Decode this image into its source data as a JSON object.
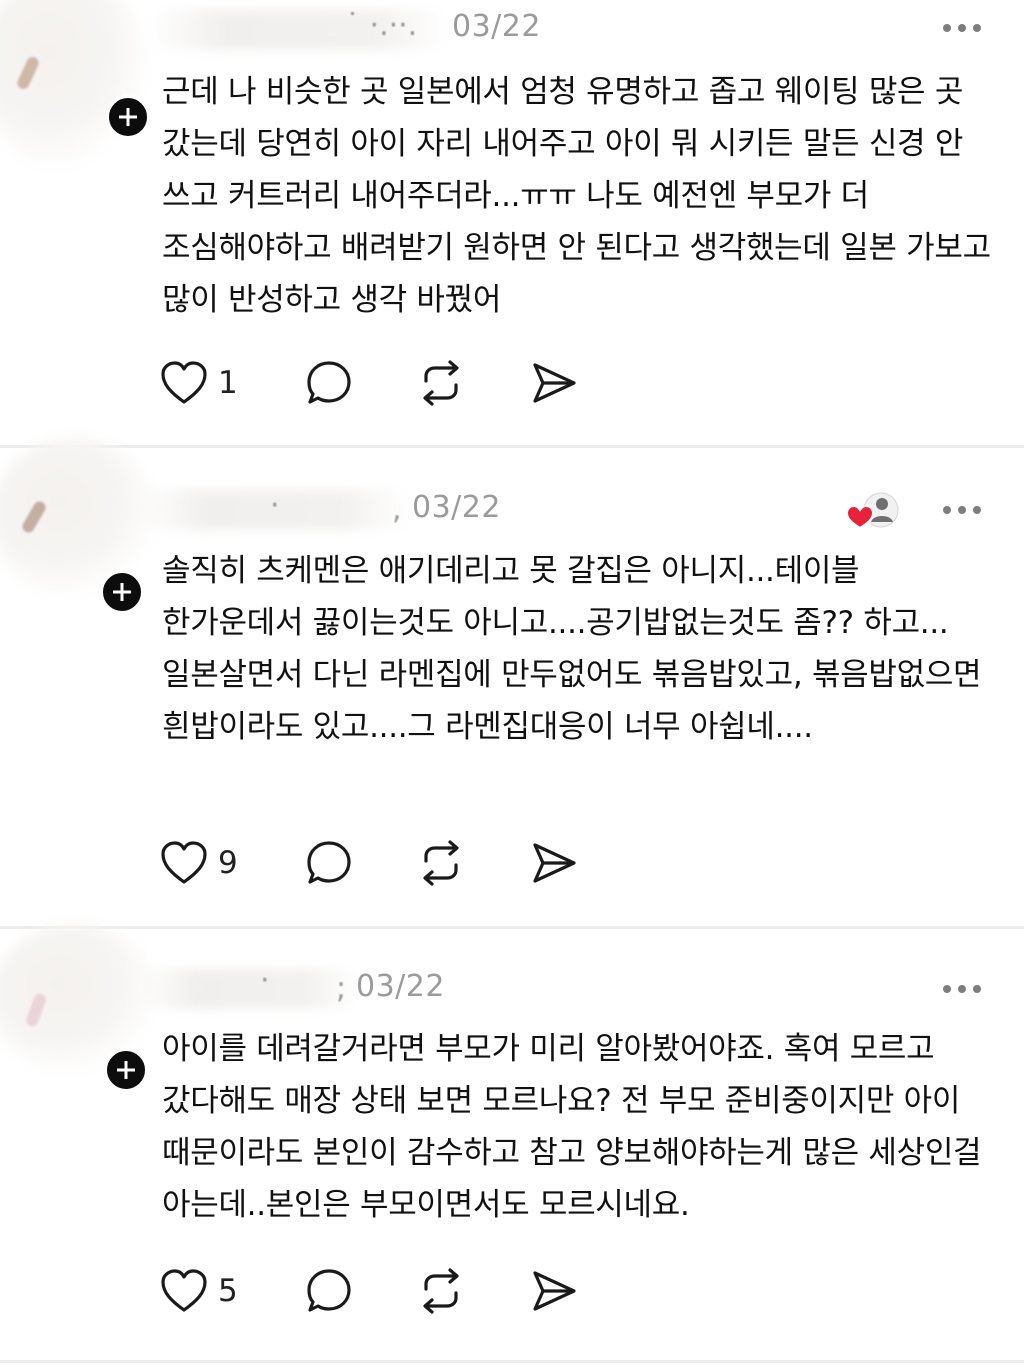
{
  "colors": {
    "text": "#111111",
    "muted": "#9b9b9b",
    "divider": "#ececec",
    "heart_red": "#e8223a",
    "badge": "#0d0d0d"
  },
  "posts": [
    {
      "timestamp": "03/22",
      "name_fragment": "",
      "body": "근데 나 비슷한 곳 일본에서 엄청 유명하고 좁고 웨이팅 많은 곳 갔는데 당연히 아이 자리 내어주고 아이 뭐 시키든 말든 신경 안 쓰고 커트러리 내어주더라...ㅠㅠ 나도 예전엔 부모가 더 조심해야하고 배려받기 원하면 안 된다고 생각했는데 일본 가보고 많이 반성하고 생각 바꿨어",
      "like_count": "1",
      "liked_by_author": false,
      "icons": [
        "heart-icon",
        "comment-icon",
        "repost-icon",
        "send-icon",
        "more-icon"
      ]
    },
    {
      "timestamp": "03/22",
      "name_fragment": "",
      "body": "솔직히 츠케멘은 애기데리고 못 갈집은 아니지...테이블 한가운데서 끓이는것도 아니고....공기밥없는것도 좀?? 하고...일본살면서 다닌 라멘집에 만두없어도 볶음밥있고, 볶음밥없으면 흰밥이라도 있고....그 라멘집대응이 너무 아쉽네....",
      "like_count": "9",
      "liked_by_author": true,
      "icons": [
        "heart-icon",
        "comment-icon",
        "repost-icon",
        "send-icon",
        "more-icon"
      ]
    },
    {
      "timestamp": "03/22",
      "name_fragment": "",
      "body": "아이를 데려갈거라면 부모가 미리 알아봤어야죠. 혹여 모르고 갔다해도 매장 상태 보면 모르나요? 전 부모 준비중이지만 아이 때문이라도 본인이 감수하고 참고 양보해야하는게 많은 세상인걸 아는데..본인은 부모이면서도 모르시네요.",
      "like_count": "5",
      "liked_by_author": false,
      "icons": [
        "heart-icon",
        "comment-icon",
        "repost-icon",
        "send-icon",
        "more-icon"
      ]
    }
  ]
}
